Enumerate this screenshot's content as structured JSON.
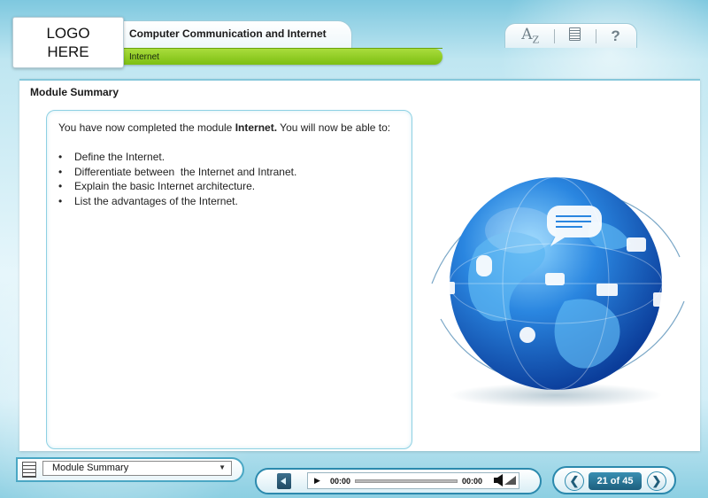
{
  "header": {
    "logo_text": "LOGO\nHERE",
    "course_title": "Computer Communication and Internet",
    "module_name": "Internet"
  },
  "toolbar": {
    "glossary_icon": "glossary-az-icon",
    "resources_icon": "resources-icon",
    "help_label": "?"
  },
  "page": {
    "title": "Module Summary",
    "intro_prefix": "You have now completed the module ",
    "intro_bold": "Internet.",
    "intro_suffix": " You will now be able to:",
    "bullet_char": "•",
    "bullets": [
      "Define the Internet.",
      "Differentiate between  the Internet and Intranet.",
      "Explain the basic Internet architecture.",
      "List the advantages of the Internet."
    ]
  },
  "footer": {
    "menu_selected": "Module Summary",
    "audio": {
      "time_current": "00:00",
      "time_total": "00:00",
      "progress": 0
    },
    "page_counter": "21 of 45"
  },
  "colors": {
    "accent_blue": "#2b89ad",
    "accent_green": "#7cbf12",
    "globe_blue": "#1f6fd1"
  }
}
